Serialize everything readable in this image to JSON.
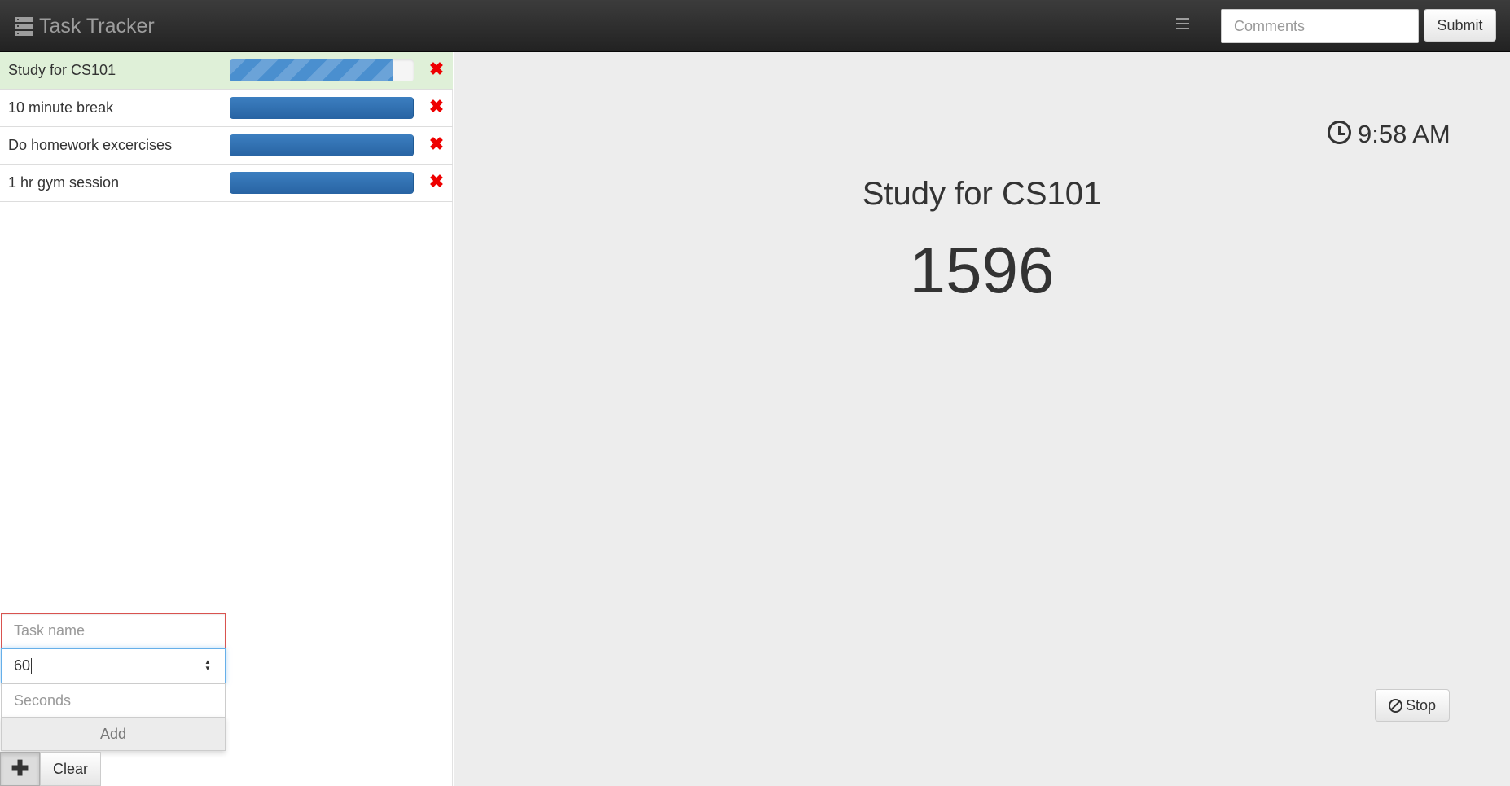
{
  "navbar": {
    "brand": "Task Tracker",
    "comments_placeholder": "Comments",
    "submit_label": "Submit"
  },
  "tasks": [
    {
      "name": "Study for CS101",
      "progress": 0.89,
      "active": true,
      "striped": true
    },
    {
      "name": "10 minute break",
      "progress": 1.0,
      "active": false,
      "striped": false
    },
    {
      "name": "Do homework excercises",
      "progress": 1.0,
      "active": false,
      "striped": false
    },
    {
      "name": "1 hr gym session",
      "progress": 1.0,
      "active": false,
      "striped": false
    }
  ],
  "form": {
    "name_placeholder": "Task name",
    "number_value": "60",
    "seconds_placeholder": "Seconds",
    "add_label": "Add",
    "plus_label": "✚",
    "clear_label": "Clear"
  },
  "main": {
    "clock_time": "9:58 AM",
    "current_task": "Study for CS101",
    "counter": "1596",
    "stop_label": "Stop"
  },
  "icons": {
    "delete": "✖",
    "spinner_up": "▲",
    "spinner_down": "▼"
  },
  "colors": {
    "active_row": "#dff0d8",
    "progress": "#2f6fb0",
    "delete": "#ee0000",
    "invalid_border": "#d9534f"
  }
}
